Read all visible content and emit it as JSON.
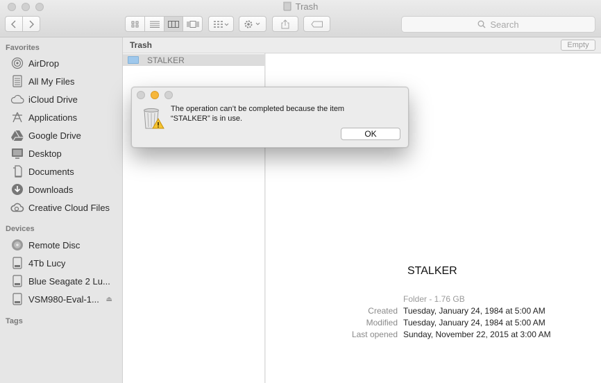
{
  "window": {
    "title": "Trash"
  },
  "toolbar": {
    "search_placeholder": "Search",
    "back_icon": "chevron-left-icon",
    "forward_icon": "chevron-right-icon"
  },
  "sidebar": {
    "favorites_header": "Favorites",
    "favorites": [
      {
        "label": "AirDrop",
        "icon": "airdrop-icon"
      },
      {
        "label": "All My Files",
        "icon": "all-files-icon"
      },
      {
        "label": "iCloud Drive",
        "icon": "cloud-icon"
      },
      {
        "label": "Applications",
        "icon": "applications-icon"
      },
      {
        "label": "Google Drive",
        "icon": "google-drive-icon"
      },
      {
        "label": "Desktop",
        "icon": "desktop-icon"
      },
      {
        "label": "Documents",
        "icon": "documents-icon"
      },
      {
        "label": "Downloads",
        "icon": "downloads-icon"
      },
      {
        "label": "Creative Cloud Files",
        "icon": "creative-cloud-icon"
      }
    ],
    "devices_header": "Devices",
    "devices": [
      {
        "label": "Remote Disc",
        "icon": "disc-icon"
      },
      {
        "label": "4Tb Lucy",
        "icon": "drive-icon"
      },
      {
        "label": "Blue Seagate 2 Lu...",
        "icon": "drive-icon"
      },
      {
        "label": "VSM980-Eval-1...",
        "icon": "drive-icon"
      }
    ],
    "tags_header": "Tags"
  },
  "main": {
    "path_title": "Trash",
    "empty_label": "Empty",
    "selected_item": "STALKER"
  },
  "preview": {
    "name": "STALKER",
    "kind": "Folder - 1.76 GB",
    "created_label": "Created",
    "created_value": "Tuesday, January 24, 1984 at 5:00 AM",
    "modified_label": "Modified",
    "modified_value": "Tuesday, January 24, 1984 at 5:00 AM",
    "opened_label": "Last opened",
    "opened_value": "Sunday, November 22, 2015 at 3:00 AM"
  },
  "dialog": {
    "line1": "The operation can’t be completed because the item",
    "line2": "“STALKER” is in use.",
    "ok_label": "OK",
    "accent_color": "#f6b73c"
  }
}
